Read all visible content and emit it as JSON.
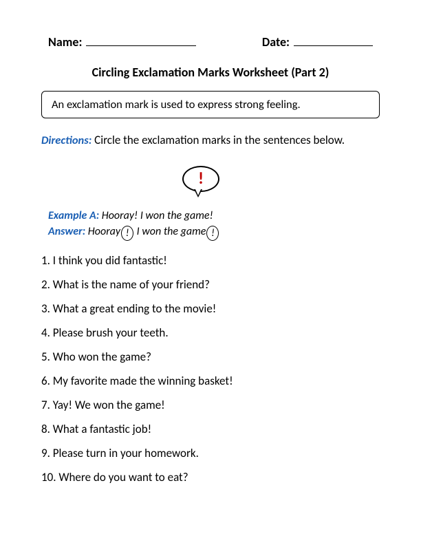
{
  "header": {
    "name_label": "Name:",
    "date_label": "Date:"
  },
  "title": "Circling Exclamation Marks Worksheet (Part 2)",
  "definition": "An exclamation mark is used to express strong feeling.",
  "directions": {
    "label": "Directions:",
    "text": "Circle the exclamation marks in the sentences below."
  },
  "bubble_mark": "!",
  "example": {
    "label_a": "Example A:",
    "text_a": "Hooray! I won the game!",
    "label_answer": "Answer:",
    "answer_part1": "Hooray",
    "answer_circ1": "!",
    "answer_part2": " I won the game",
    "answer_circ2": "!"
  },
  "questions": [
    "1. I think you did fantastic!",
    "2. What is the name of your friend?",
    "3. What a great ending to the movie!",
    "4. Please brush your teeth.",
    "5. Who won the game?",
    "6. My favorite made the winning basket!",
    "7. Yay! We won the game!",
    "8. What a fantastic job!",
    "9. Please turn in your homework.",
    "10. Where do you want to eat?"
  ]
}
